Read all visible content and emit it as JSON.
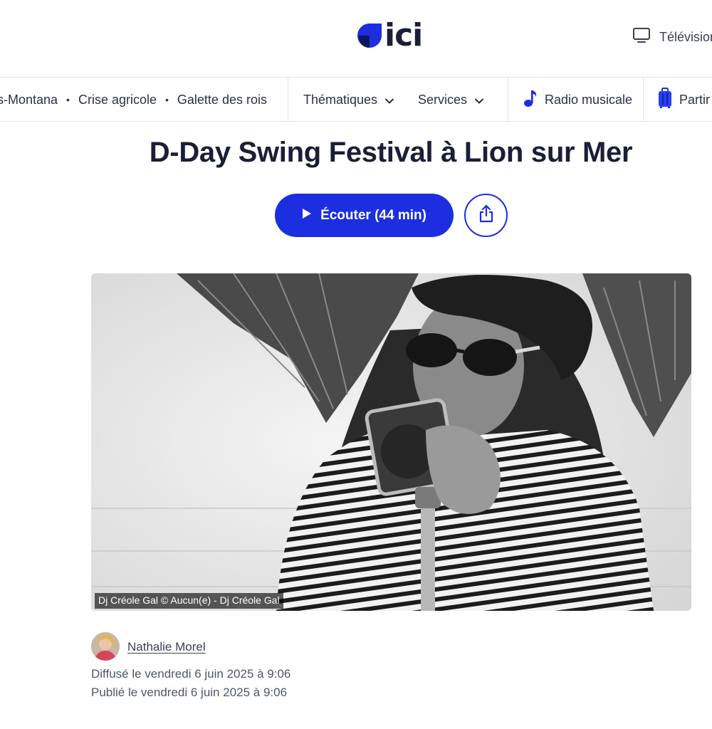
{
  "header": {
    "logo_text": "ici",
    "tv_label": "Télévision",
    "brand_color": "#1d2ee0"
  },
  "nav": {
    "topics": [
      "s-Montana",
      "Crise agricole",
      "Galette des rois"
    ],
    "separator": "•",
    "thematiques": "Thématiques",
    "services": "Services",
    "radio": "Radio musicale",
    "partir": "Partir"
  },
  "article": {
    "title": "D-Day Swing Festival à Lion sur Mer",
    "listen_label": "Écouter (44 min)",
    "caption": "Dj Créole Gal © Aucun(e) - Dj Créole Gal",
    "author": "Nathalie Morel",
    "broadcast": "Diffusé le vendredi 6 juin 2025 à 9:06",
    "published": "Publié le vendredi 6 juin 2025 à 9:06"
  },
  "icons": {
    "logo": "ici-logo-icon",
    "tv": "tv-icon",
    "chevron": "chevron-down-icon",
    "music": "music-note-icon",
    "suitcase": "suitcase-icon",
    "play": "play-icon",
    "share": "share-icon"
  }
}
